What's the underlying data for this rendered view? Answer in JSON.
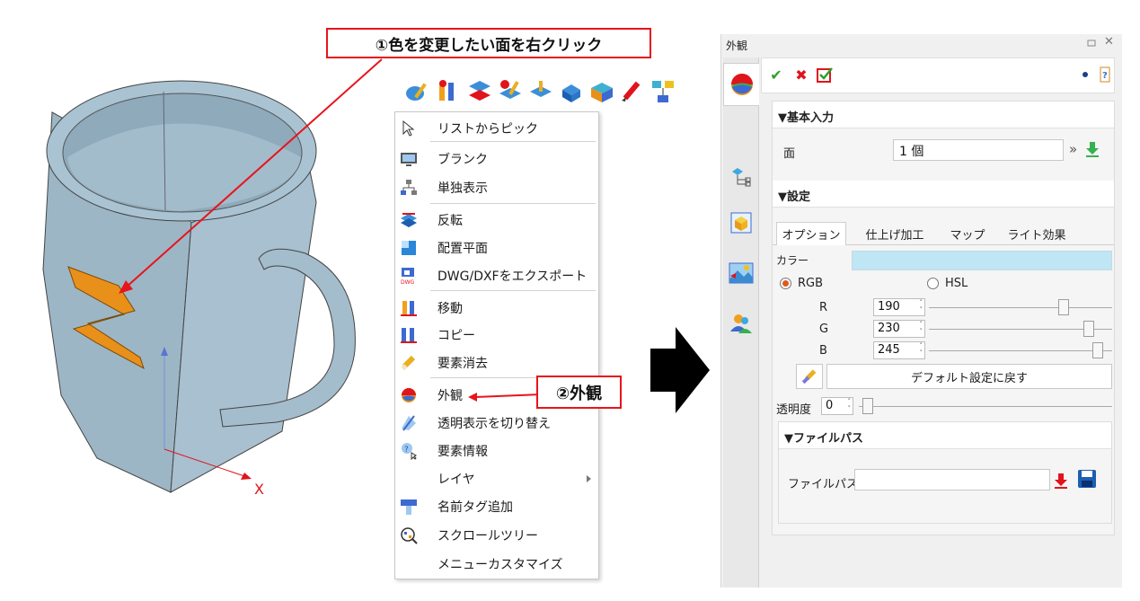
{
  "callouts": {
    "step1": "①色を変更したい面を右クリック",
    "step2": "②外観"
  },
  "viewport": {
    "axis_x_label": "X"
  },
  "toolbar_icons": [
    "appearance-edit-icon",
    "de-move-icon",
    "flip-face-icon",
    "de-edit-icon",
    "face-icon",
    "solid-face-icon",
    "shaded-box-icon",
    "pen-edit-icon",
    "structure-icon"
  ],
  "context_menu": {
    "items": [
      {
        "label": "リストからピック",
        "icon": "cursor-icon"
      },
      {
        "label": "ブランク",
        "icon": "monitor-icon"
      },
      {
        "label": "単独表示",
        "icon": "hierarchy-icon"
      },
      {
        "label": "反転",
        "icon": "flip-icon"
      },
      {
        "label": "配置平面",
        "icon": "plane-icon"
      },
      {
        "label": "DWG/DXFをエクスポート",
        "icon": "dwg-icon"
      },
      {
        "label": "移動",
        "icon": "move-icon"
      },
      {
        "label": "コピー",
        "icon": "copy-icon"
      },
      {
        "label": "要素消去",
        "icon": "eraser-icon"
      },
      {
        "label": "外観",
        "icon": "appearance-icon"
      },
      {
        "label": "透明表示を切り替え",
        "icon": "transparent-icon"
      },
      {
        "label": "要素情報",
        "icon": "info-icon"
      },
      {
        "label": "レイヤ",
        "icon": ""
      },
      {
        "label": "名前タグ追加",
        "icon": "name-tag-icon"
      },
      {
        "label": "スクロールツリー",
        "icon": "scroll-tree-icon"
      },
      {
        "label": "メニューカスタマイズ",
        "icon": ""
      }
    ]
  },
  "panel": {
    "title": "外観",
    "basic_input": {
      "header": "▼基本入力",
      "face_label": "面",
      "face_value": "1 個"
    },
    "settings": {
      "header": "▼設定",
      "tabs": [
        "オプション",
        "仕上げ加工",
        "マップ",
        "ライト効果"
      ],
      "color_label": "カラー",
      "color_hex": "#bee6f5",
      "rgb_label": "RGB",
      "hsl_label": "HSL",
      "r_label": "R",
      "g_label": "G",
      "b_label": "B",
      "r_value": "190",
      "g_value": "230",
      "b_value": "245",
      "reset_label": "デフォルト設定に戻す",
      "transparency_label": "透明度",
      "transparency_value": "0"
    },
    "file_path": {
      "header": "▼ファイルパス",
      "label": "ファイルパス",
      "value": ""
    }
  },
  "colors": {
    "callout_red": "#e8141c",
    "mug": "#9fb8c8",
    "z_orange": "#e8901a"
  }
}
